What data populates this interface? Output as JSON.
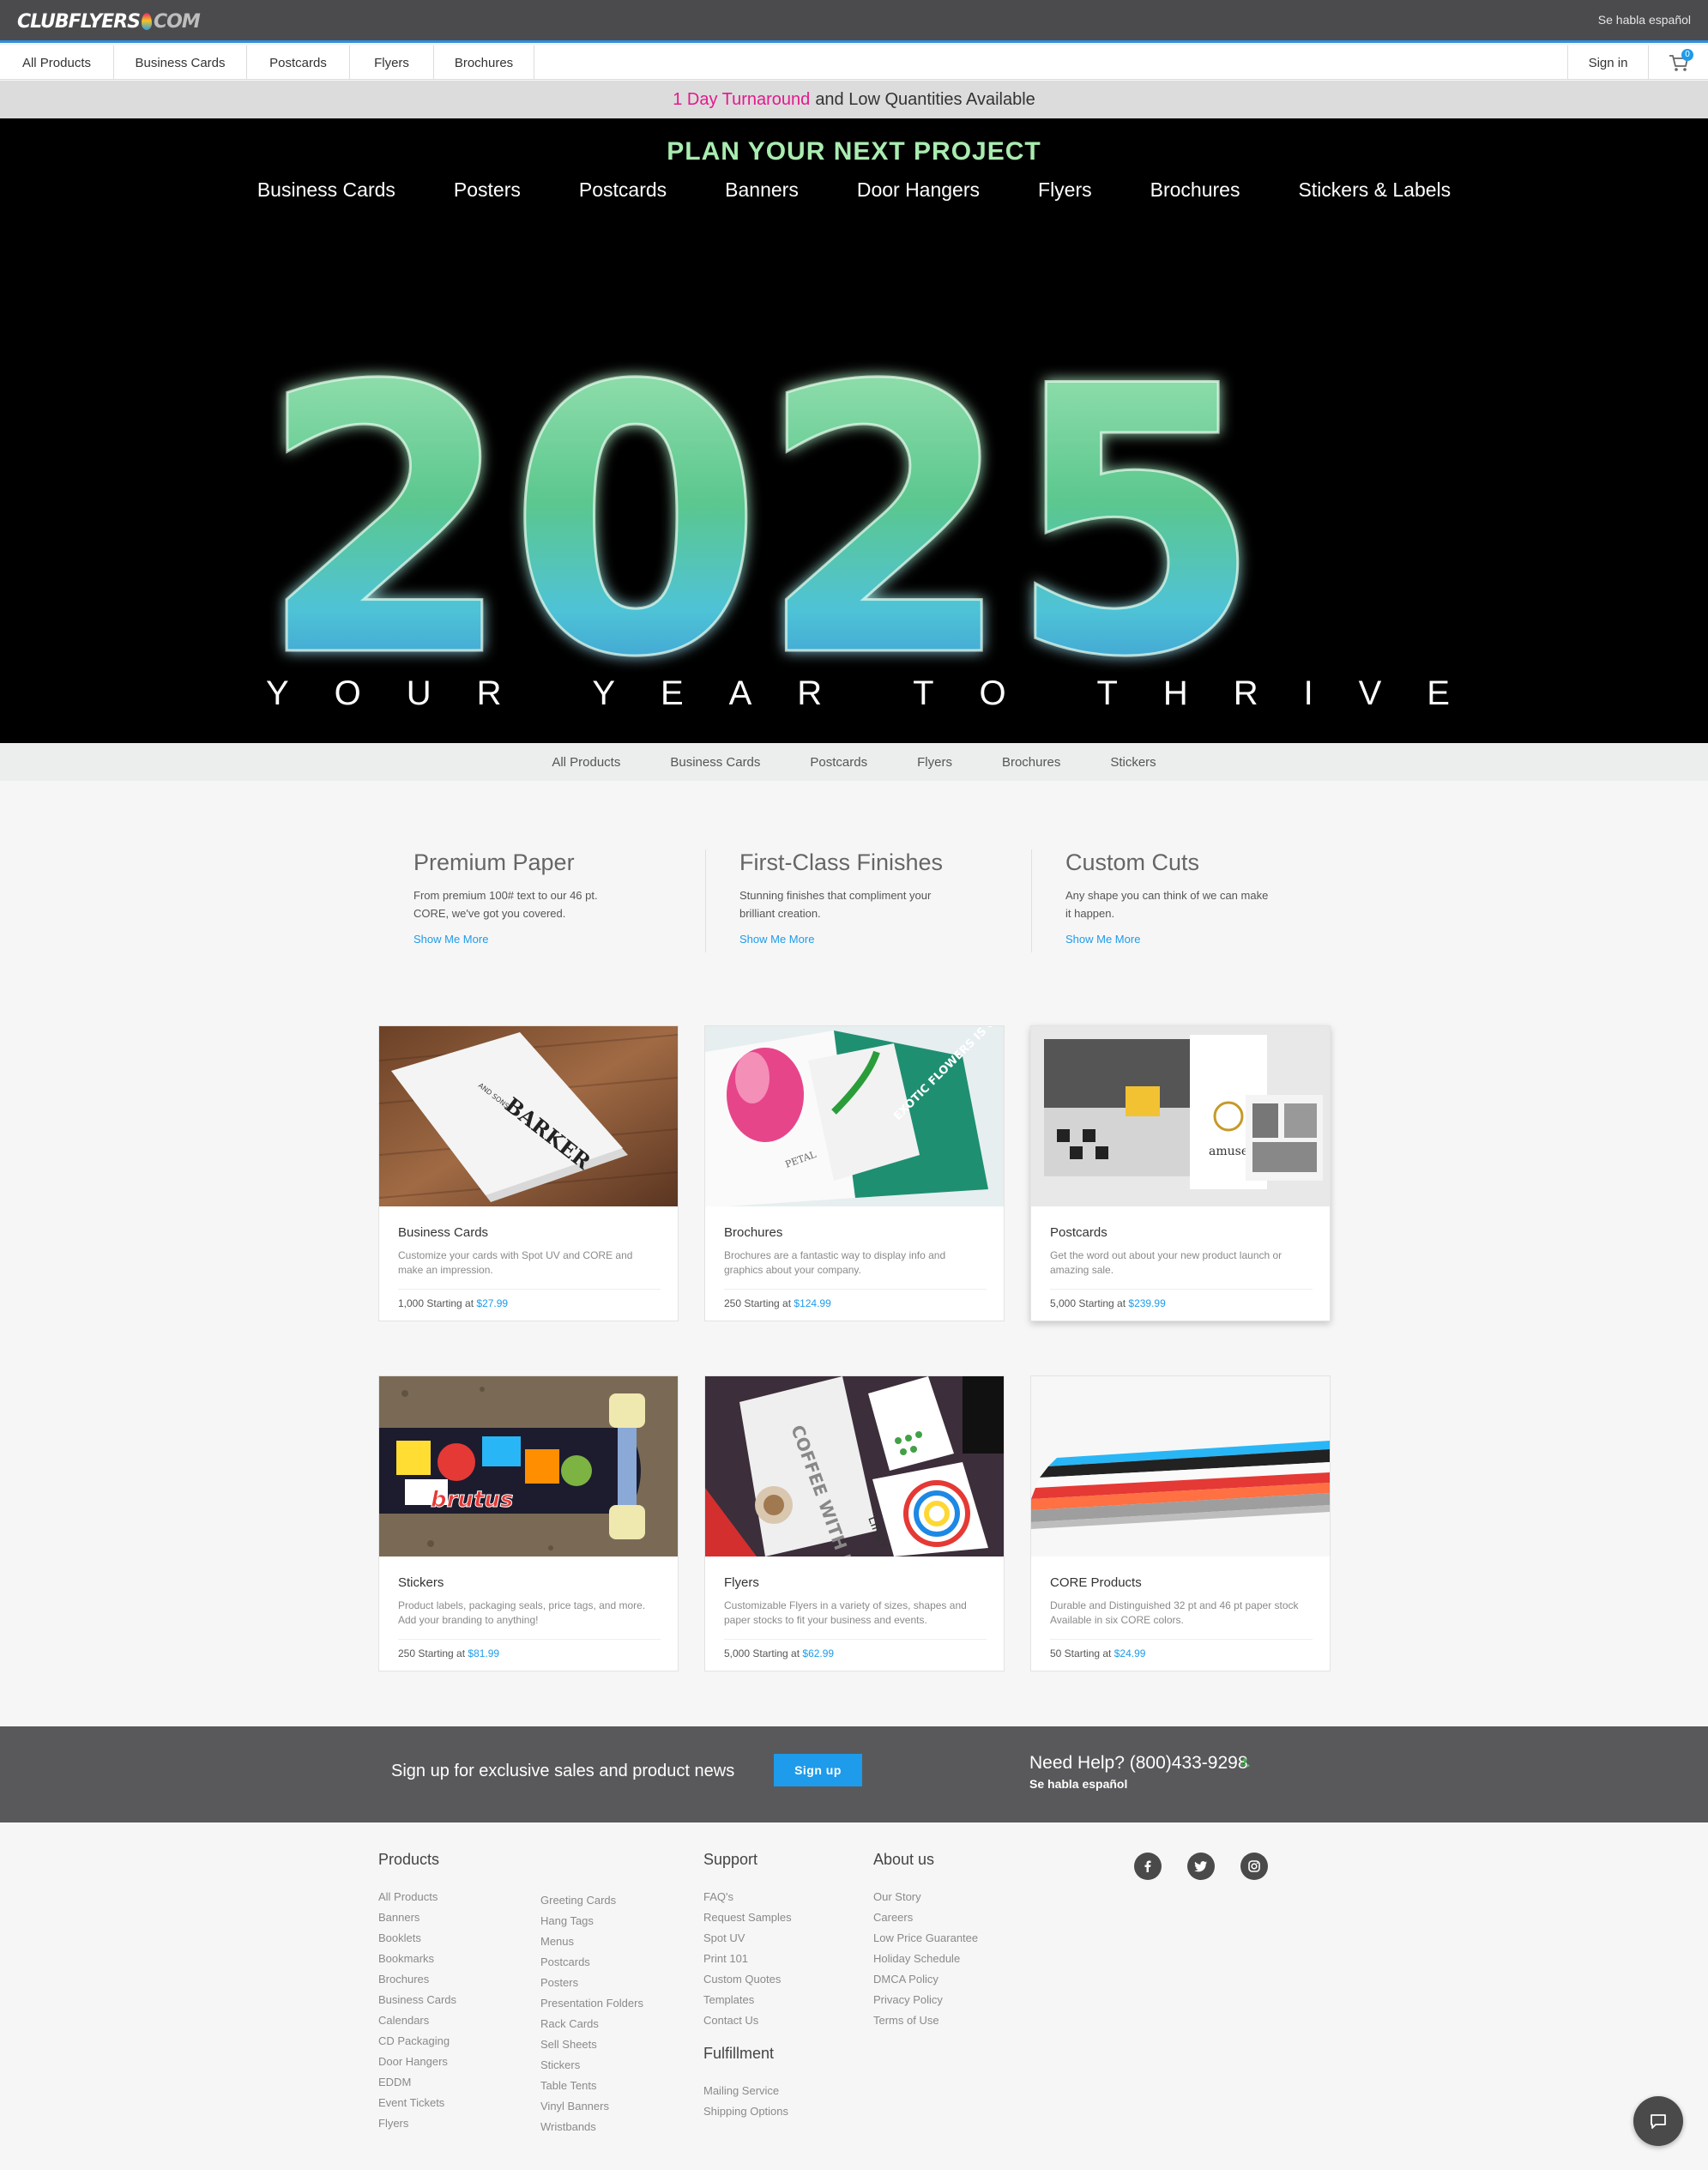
{
  "header": {
    "logo_main": "CLUBFLYERS",
    "logo_suffix": "COM",
    "habla": "Se habla español"
  },
  "nav": {
    "items": [
      "All Products",
      "Business Cards",
      "Postcards",
      "Flyers",
      "Brochures"
    ],
    "signin": "Sign in",
    "cart_count": "0"
  },
  "promo": {
    "highlight": "1 Day Turnaround",
    "rest": "and Low Quantities Available",
    "highlight_color": "#e21a8c"
  },
  "hero": {
    "title": "PLAN YOUR NEXT PROJECT",
    "links": [
      "Business Cards",
      "Posters",
      "Postcards",
      "Banners",
      "Door Hangers",
      "Flyers",
      "Brochures",
      "Stickers & Labels"
    ],
    "year": "2025",
    "tagline_letters": [
      "Y",
      "O",
      "U",
      "R",
      "Y",
      "E",
      "A",
      "R",
      "T",
      "O",
      "T",
      "H",
      "R",
      "I",
      "V",
      "E"
    ]
  },
  "subnav": {
    "items": [
      "All Products",
      "Business Cards",
      "Postcards",
      "Flyers",
      "Brochures",
      "Stickers"
    ]
  },
  "features": [
    {
      "title": "Premium Paper",
      "text": "From premium 100# text to our 46 pt. CORE, we've got you covered.",
      "link": "Show Me More"
    },
    {
      "title": "First-Class Finishes",
      "text": "Stunning finishes that compliment your brilliant creation.",
      "link": "Show Me More"
    },
    {
      "title": "Custom Cuts",
      "text": "Any shape you can think of we can make it happen.",
      "link": "Show Me More"
    }
  ],
  "products": [
    {
      "name": "Business Cards",
      "desc": "Customize your cards with Spot UV and CORE and make an impression.",
      "qty": "1,000 Starting at",
      "price": "$27.99",
      "photo_text": "BARKER",
      "photo_sub": "AND SONS"
    },
    {
      "name": "Brochures",
      "desc": "Brochures are a fantastic way to display info and graphics about your company.",
      "qty": "250 Starting at",
      "price": "$124.99",
      "photo_text": "PETAL",
      "photo_sub": "EXOTIC FLOWERS IS OUR BUSINESS"
    },
    {
      "name": "Postcards",
      "desc": "Get the word out about your new product launch or amazing sale.",
      "qty": "5,000 Starting at",
      "price": "$239.99",
      "photo_text": "amuse"
    },
    {
      "name": "Stickers",
      "desc": "Product labels, packaging seals, price tags, and more. Add your branding to anything!",
      "qty": "250 Starting at",
      "price": "$81.99",
      "photo_text": "brutus"
    },
    {
      "name": "Flyers",
      "desc": "Customizable Flyers in a variety of sizes, shapes and paper stocks to fit your business and events.",
      "qty": "5,000 Starting at",
      "price": "$62.99",
      "photo_text": "COFFEE WITH FRIENDS",
      "photo_sub": "LINKY"
    },
    {
      "name": "CORE Products",
      "desc": "Durable and Distinguished 32 pt and 46 pt paper stock Available in six CORE colors.",
      "qty": "50 Starting at",
      "price": "$24.99"
    }
  ],
  "signup": {
    "message": "Sign up for exclusive sales and product news",
    "button": "Sign up",
    "help": "Need Help? (800)433-9298",
    "habla": "Se habla español"
  },
  "footer": {
    "products_title": "Products",
    "products_col1": [
      "All Products",
      "Banners",
      "Booklets",
      "Bookmarks",
      "Brochures",
      "Business Cards",
      "Calendars",
      "CD Packaging",
      "Door Hangers",
      "EDDM",
      "Event Tickets",
      "Flyers"
    ],
    "products_col2": [
      "Greeting Cards",
      "Hang Tags",
      "Menus",
      "Postcards",
      "Posters",
      "Presentation Folders",
      "Rack Cards",
      "Sell Sheets",
      "Stickers",
      "Table Tents",
      "Vinyl Banners",
      "Wristbands"
    ],
    "support_title": "Support",
    "support": [
      "FAQ's",
      "Request Samples",
      "Spot UV",
      "Print 101",
      "Custom Quotes",
      "Templates",
      "Contact Us"
    ],
    "fulfillment_title": "Fulfillment",
    "fulfillment": [
      "Mailing Service",
      "Shipping Options"
    ],
    "about_title": "About us",
    "about": [
      "Our Story",
      "Careers",
      "Low Price Guarantee",
      "Holiday Schedule",
      "DMCA Policy",
      "Privacy Policy",
      "Terms of Use"
    ],
    "social": [
      "facebook-icon",
      "twitter-icon",
      "instagram-icon"
    ]
  }
}
